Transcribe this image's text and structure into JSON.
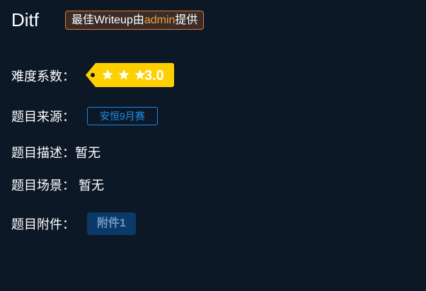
{
  "header": {
    "title": "Ditf",
    "writeup_prefix": "最佳Writeup由",
    "writeup_user": "admin",
    "writeup_suffix": "提供"
  },
  "fields": {
    "difficulty_label": "难度系数：",
    "difficulty_value": "3.0",
    "difficulty_stars": 3,
    "source_label": "题目来源：",
    "source_value": "安恒9月赛",
    "desc_label": "题目描述：",
    "desc_value": "暂无",
    "scene_label": "题目场景：",
    "scene_value": "暂无",
    "attachment_label": "题目附件：",
    "attachment_value": "附件1"
  },
  "colors": {
    "background": "#0d1827",
    "tag": "#ffd000",
    "writeup_border": "#e27a2e",
    "source": "#1e86e8",
    "attachment_bg": "#0b3a68"
  }
}
